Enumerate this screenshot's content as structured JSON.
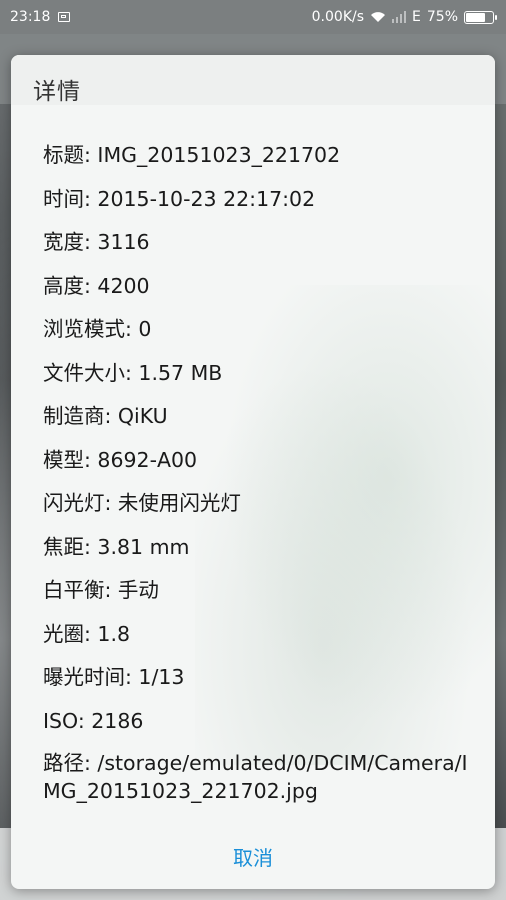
{
  "status_bar": {
    "time": "23:18",
    "network_speed": "0.00K/s",
    "network_type": "E",
    "battery_percent_text": "75%",
    "battery_level": 0.75
  },
  "dialog": {
    "title": "详情",
    "rows": [
      "标题: IMG_20151023_221702",
      "时间: 2015-10-23 22:17:02",
      "宽度: 3116",
      "高度: 4200",
      "浏览模式: 0",
      "文件大小: 1.57 MB",
      "制造商: QiKU",
      "模型: 8692-A00",
      "闪光灯: 未使用闪光灯",
      "焦距: 3.81 mm",
      "白平衡: 手动",
      "光圈: 1.8",
      "曝光时间: 1/13",
      "ISO: 2186",
      "路径: /storage/emulated/0/DCIM/Camera/IMG_20151023_221702.jpg"
    ],
    "cancel_label": "取消"
  }
}
